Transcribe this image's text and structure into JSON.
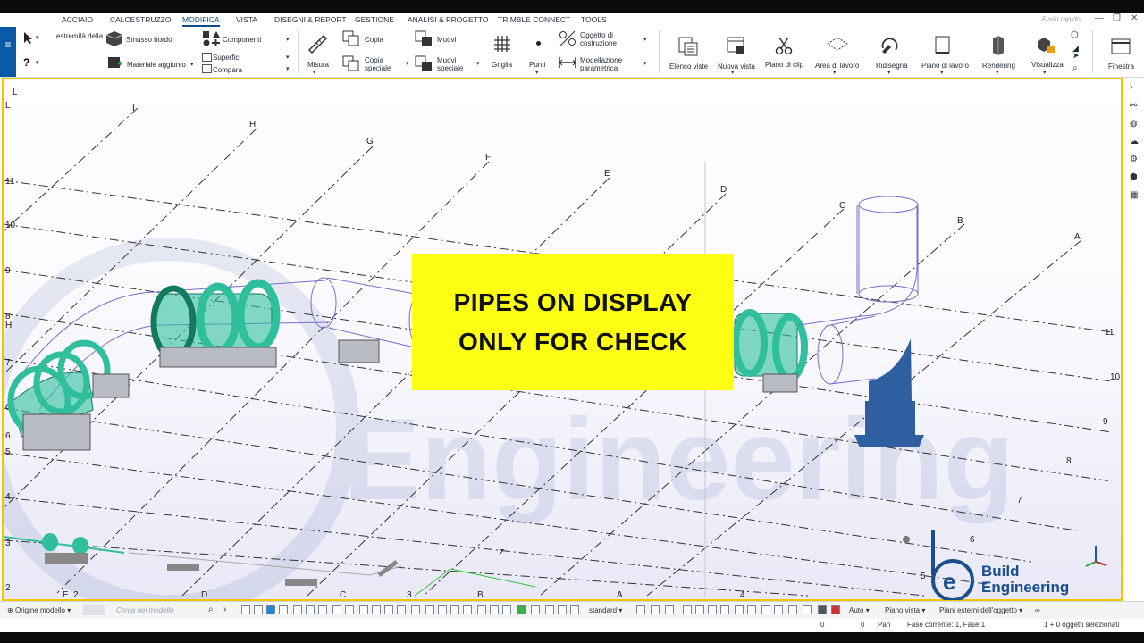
{
  "menu": {
    "tabs": [
      "ACCIAIO",
      "CALCESTRUZZO",
      "MODIFICA",
      "VISTA",
      "DISEGNI & REPORT",
      "GESTIONE",
      "ANALISI & PROGETTO",
      "TRIMBLE CONNECT",
      "TOOLS"
    ],
    "active_tab": "MODIFICA",
    "quick_launch_placeholder": "Avvio rapido"
  },
  "ribbon": {
    "estremita": "estremità della",
    "smusso": "Smusso bordo",
    "materiale": "Materiale aggiunto",
    "componenti": "Componenti",
    "superfici": "Superfici",
    "compara": "Compara",
    "misura": "Misura",
    "copia": "Copia",
    "copia_speciale_1": "Copia",
    "copia_speciale_2": "speciale",
    "muovi": "Muovi",
    "muovi_speciale_1": "Muovi",
    "muovi_speciale_2": "speciale",
    "griglia": "Griglia",
    "punti": "Punti",
    "oggetto_1": "Oggetto di",
    "oggetto_2": "costruzione",
    "modellazione_1": "Modellazione",
    "modellazione_2": "parametrica",
    "elenco_viste": "Elenco viste",
    "nuova_vista": "Nuova vista",
    "piano_clip": "Piano di clip",
    "area_lavoro": "Area di lavoro",
    "ridisegna": "Ridisegna",
    "piano_lavoro": "Piano di lavoro",
    "rendering": "Rendering",
    "visualizza": "Visualizza",
    "finestra": "Finestra"
  },
  "viewport": {
    "overlay_line1": "PIPES ON DISPLAY",
    "overlay_line2": "ONLY FOR CHECK",
    "grid_letters": [
      "L",
      "I",
      "H",
      "G",
      "F",
      "E",
      "D",
      "C",
      "B",
      "A"
    ],
    "grid_numbers_left": [
      "11",
      "10",
      "9",
      "8",
      "7",
      "6",
      "5",
      "4",
      "3",
      "2"
    ],
    "grid_numbers_right": [
      "11",
      "10",
      "9",
      "8",
      "7",
      "6",
      "5"
    ],
    "bottom_labels": [
      "E",
      "2",
      "D",
      "C",
      "3",
      "B",
      "A",
      "4"
    ],
    "left_extra": [
      "L",
      "H",
      "6"
    ],
    "z_label": "Z",
    "watermark": "Engineering",
    "logo_line1": "Build",
    "logo_line2": "Engineering",
    "pipe_color": "#2fbf9c",
    "fitting_color": "#2f5fa0"
  },
  "bottom": {
    "origine": "Origine modello",
    "cerca_placeholder": "Cerca nel modello",
    "standard": "standard",
    "auto": "Auto",
    "piano_vista": "Piano vista",
    "piani_esterni": "Piani esterni dell'oggetto"
  },
  "status": {
    "coord1": "0",
    "coord2": "0",
    "mode": "Pan",
    "fase": "Fase corrente: 1, Fase 1",
    "selected": "1 + 0 oggetti selezionati"
  }
}
